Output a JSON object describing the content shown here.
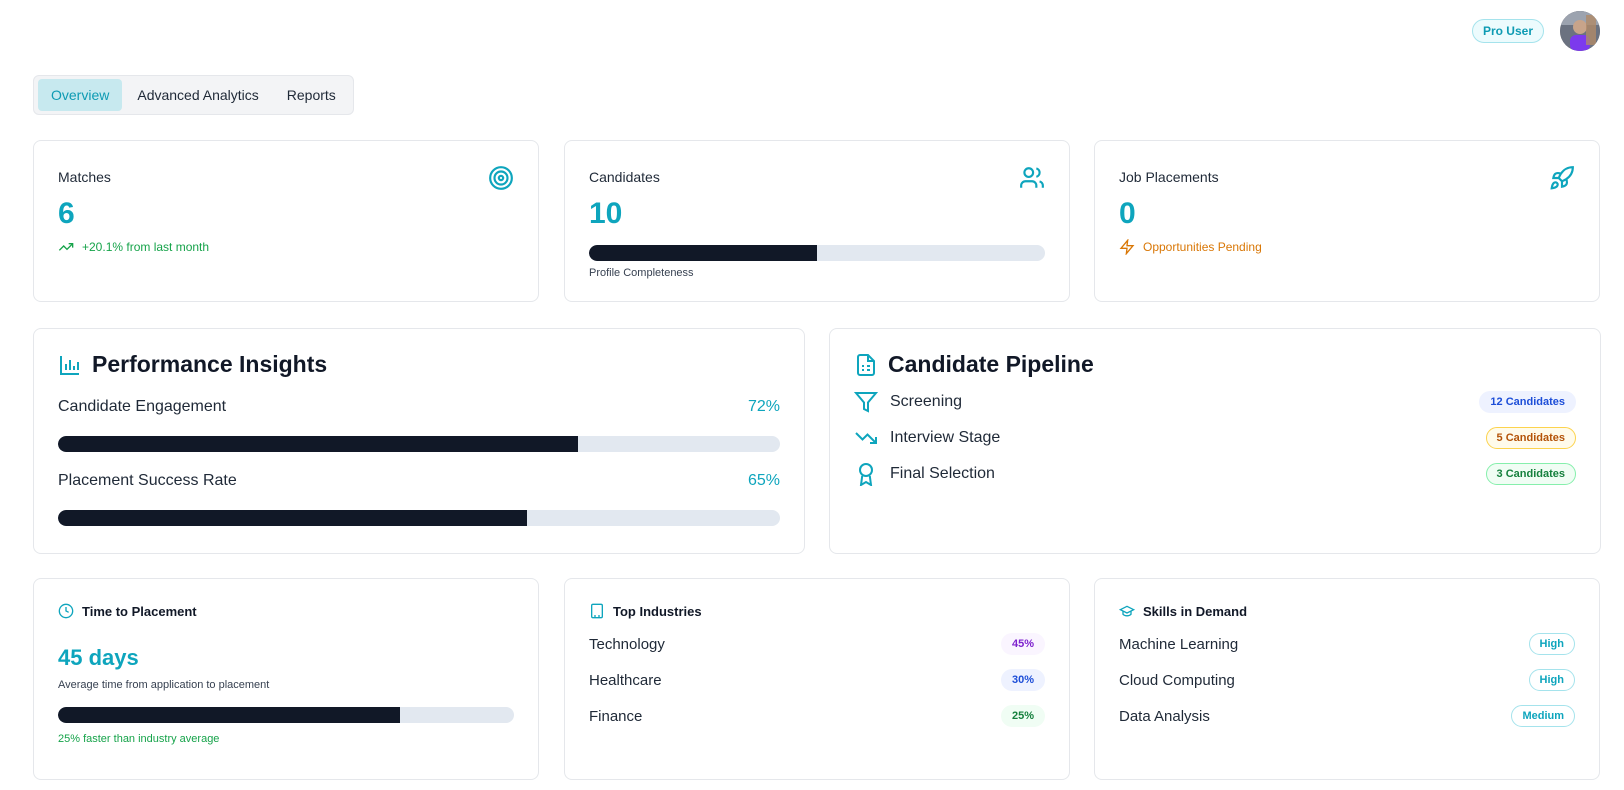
{
  "header": {
    "badge": "Pro User"
  },
  "tabs": [
    {
      "label": "Overview",
      "active": true
    },
    {
      "label": "Advanced Analytics",
      "active": false
    },
    {
      "label": "Reports",
      "active": false
    }
  ],
  "stats": {
    "matches": {
      "title": "Matches",
      "value": "6",
      "note": "+20.1% from last month"
    },
    "candidates": {
      "title": "Candidates",
      "value": "10",
      "progress": 0.5,
      "progress_label": "Profile Completeness"
    },
    "placements": {
      "title": "Job Placements",
      "value": "0",
      "note": "Opportunities Pending"
    }
  },
  "insights": {
    "title": "Performance Insights",
    "metrics": [
      {
        "label": "Candidate Engagement",
        "value": "72%",
        "fraction": 0.72
      },
      {
        "label": "Placement Success Rate",
        "value": "65%",
        "fraction": 0.65
      }
    ]
  },
  "pipeline": {
    "title": "Candidate Pipeline",
    "stages": [
      {
        "label": "Screening",
        "count": "12 Candidates",
        "icon": "funnel-icon"
      },
      {
        "label": "Interview Stage",
        "count": "5 Candidates",
        "icon": "trending-down-icon"
      },
      {
        "label": "Final Selection",
        "count": "3 Candidates",
        "icon": "award-icon"
      }
    ]
  },
  "time_to_placement": {
    "title": "Time to Placement",
    "value": "45 days",
    "description": "Average time from application to placement",
    "fraction": 0.75,
    "note": "25% faster than industry average"
  },
  "industries": {
    "title": "Top Industries",
    "items": [
      {
        "label": "Technology",
        "value": "45%"
      },
      {
        "label": "Healthcare",
        "value": "30%"
      },
      {
        "label": "Finance",
        "value": "25%"
      }
    ]
  },
  "skills": {
    "title": "Skills in Demand",
    "items": [
      {
        "label": "Machine Learning",
        "level": "High"
      },
      {
        "label": "Cloud Computing",
        "level": "High"
      },
      {
        "label": "Data Analysis",
        "level": "Medium"
      }
    ]
  }
}
